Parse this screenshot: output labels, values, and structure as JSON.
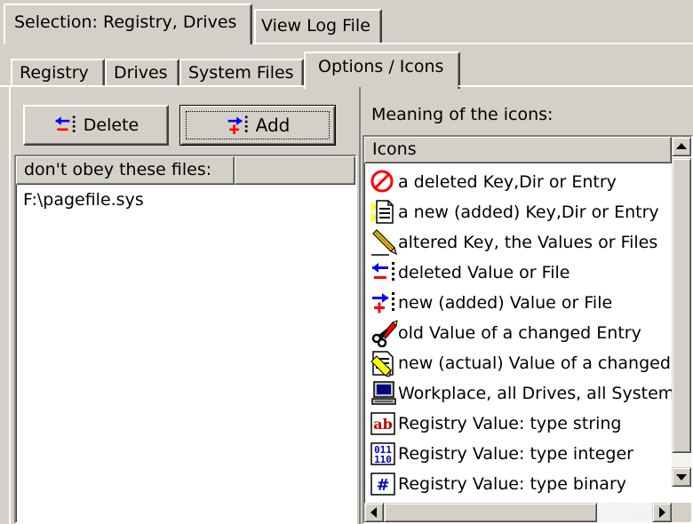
{
  "top_tabs": [
    {
      "label": "Selection: Registry, Drives",
      "active": true
    },
    {
      "label": "View Log File",
      "active": false
    }
  ],
  "sub_tabs": [
    {
      "label": "Registry",
      "active": false
    },
    {
      "label": "Drives",
      "active": false
    },
    {
      "label": "System Files",
      "active": false
    },
    {
      "label": "Options / Icons",
      "active": true
    }
  ],
  "buttons": {
    "delete_label": "Delete",
    "add_label": "Add"
  },
  "exclude_list": {
    "header": "don't obey these files:",
    "items": [
      "F:\\pagefile.sys"
    ]
  },
  "icons_panel": {
    "caption": "Meaning of the icons:",
    "header": "Icons",
    "items": [
      {
        "icon": "no-entry-icon",
        "label": "a deleted Key,Dir or Entry"
      },
      {
        "icon": "new-document-icon",
        "label": "a new (added) Key,Dir or Entry"
      },
      {
        "icon": "pencil-icon",
        "label": "altered Key, the Values or Files"
      },
      {
        "icon": "deleted-value-icon",
        "label": "deleted Value or File"
      },
      {
        "icon": "new-value-icon",
        "label": "new (added) Value or File"
      },
      {
        "icon": "scissors-pen-icon",
        "label": "old Value of a changed Entry"
      },
      {
        "icon": "changed-document-icon",
        "label": "new (actual) Value of a changed Entry"
      },
      {
        "icon": "computer-icon",
        "label": "Workplace, all Drives, all System Files"
      },
      {
        "icon": "string-value-icon",
        "label": "Registry Value: type string"
      },
      {
        "icon": "integer-value-icon",
        "label": "Registry Value: type integer"
      },
      {
        "icon": "binary-value-icon",
        "label": "Registry Value: type binary"
      }
    ]
  },
  "colors": {
    "face": "#d4d0c8",
    "red": "#ff0000",
    "blue": "#0000ff",
    "window": "#ffffff"
  }
}
